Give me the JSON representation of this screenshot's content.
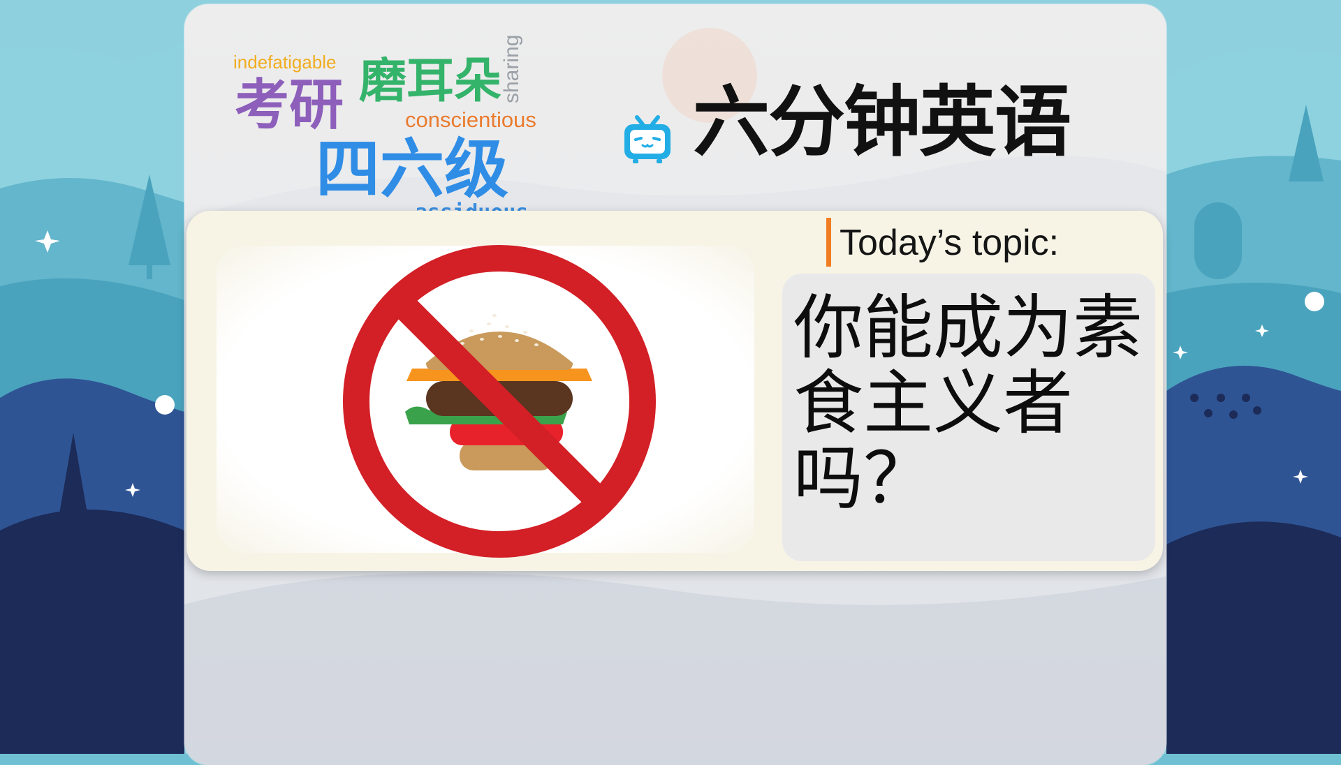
{
  "background": {
    "colors": {
      "light": "#8fd0de",
      "mid": "#5fb3c9",
      "dark": "#2b4a86",
      "darkest": "#1b2a55"
    }
  },
  "word_cloud": {
    "indefatigable": "indefatigable",
    "kaoyan": "考研",
    "moerduo": "磨耳朵",
    "sharing": "sharing",
    "conscientious": "conscientious",
    "siliuji": "四六级",
    "assiduous": "assiduous"
  },
  "header": {
    "title": "六分钟英语",
    "logo_icon": "tv-icon",
    "logo_color": "#23ade5"
  },
  "card": {
    "image_icon": "no-burger-icon",
    "topic_label": "Today’s topic:",
    "topic_text": "你能成为素食主义者吗？",
    "accent_color": "#f07d22"
  }
}
